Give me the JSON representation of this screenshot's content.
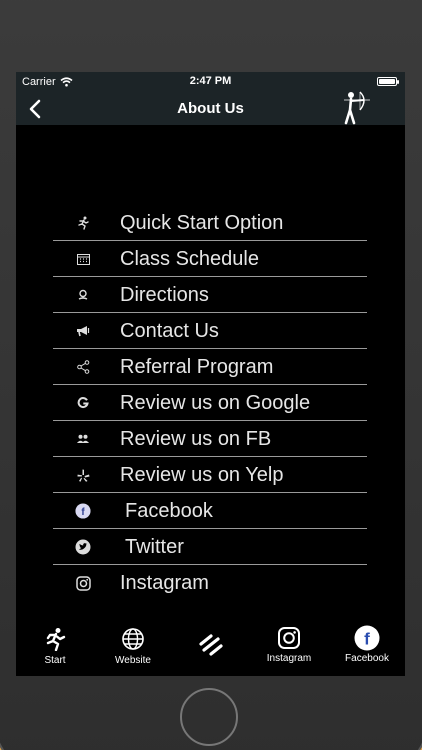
{
  "status": {
    "carrier": "Carrier",
    "time": "2:47 PM",
    "wifi_icon": "wifi-icon",
    "battery_icon": "battery-icon"
  },
  "navbar": {
    "title": "About Us",
    "back_icon": "chevron-left-icon",
    "logo": "archer-logo"
  },
  "menu": [
    {
      "label": "Quick Start Option",
      "icon": "running-icon"
    },
    {
      "label": "Class Schedule",
      "icon": "calendar-icon"
    },
    {
      "label": "Directions",
      "icon": "map-pin-icon"
    },
    {
      "label": "Contact Us",
      "icon": "megaphone-icon"
    },
    {
      "label": "Referral Program",
      "icon": "share-icon"
    },
    {
      "label": "Review us on Google",
      "icon": "google-icon"
    },
    {
      "label": "Review us on FB",
      "icon": "users-icon"
    },
    {
      "label": "Review us on Yelp",
      "icon": "yelp-icon"
    },
    {
      "label": "Facebook",
      "icon": "facebook-icon"
    },
    {
      "label": "Twitter",
      "icon": "twitter-icon"
    },
    {
      "label": "Instagram",
      "icon": "instagram-icon"
    }
  ],
  "tabs": [
    {
      "label": "Start",
      "icon": "running-icon"
    },
    {
      "label": "Website",
      "icon": "globe-icon"
    },
    {
      "label": "",
      "icon": "menu-lines-icon"
    },
    {
      "label": "Instagram",
      "icon": "instagram-icon"
    },
    {
      "label": "Facebook",
      "icon": "facebook-icon"
    }
  ],
  "colors": {
    "bar_background": "#1c2427",
    "screen_background": "#000000",
    "text": "#e6e6e6",
    "divider": "#9a9a9a",
    "device_frame": "#333333",
    "backdrop": "#e0a24a"
  }
}
